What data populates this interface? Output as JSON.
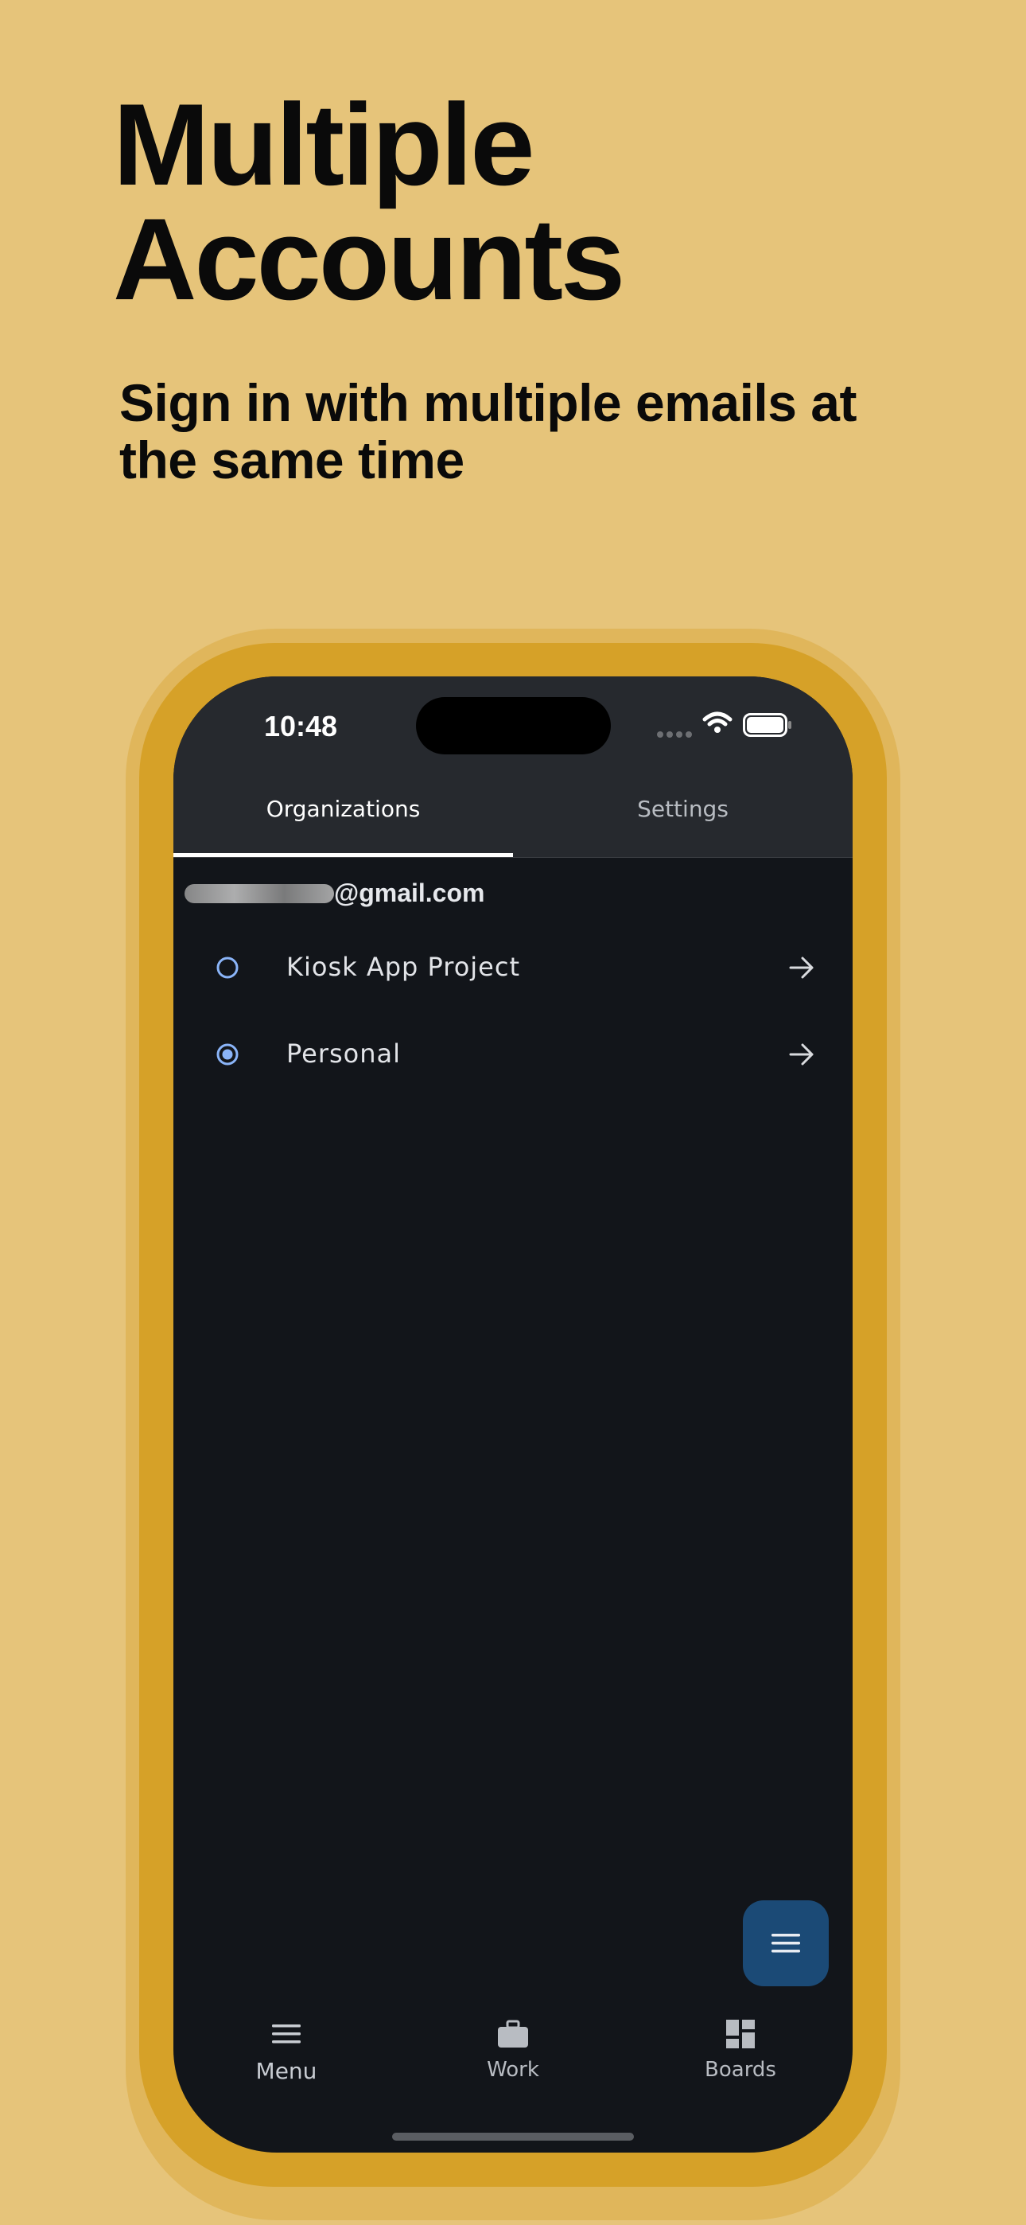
{
  "headline": "Multiple Accounts",
  "subheadline": "Sign in with multiple emails at the same time",
  "status_bar": {
    "time": "10:48"
  },
  "tabs": [
    {
      "label": "Organizations",
      "selected": true
    },
    {
      "label": "Settings",
      "selected": false
    }
  ],
  "account": {
    "email_suffix": "@gmail.com"
  },
  "organizations": [
    {
      "label": "Kiosk App Project",
      "selected": false,
      "icon": "arrow-right-icon"
    },
    {
      "label": "Personal",
      "selected": true,
      "icon": "arrow-right-icon"
    }
  ],
  "fab": {
    "icon": "menu-icon"
  },
  "bottom_nav": [
    {
      "label": "Menu",
      "icon": "menu-icon"
    },
    {
      "label": "Work",
      "icon": "briefcase-icon"
    },
    {
      "label": "Boards",
      "icon": "dashboard-icon"
    }
  ],
  "colors": {
    "background": "#E6C47A",
    "phone_frame": "#D6A128",
    "screen": "#12151A",
    "topbar": "#26292E",
    "accent": "#8AB4F8",
    "fab": "#1B4A76"
  }
}
